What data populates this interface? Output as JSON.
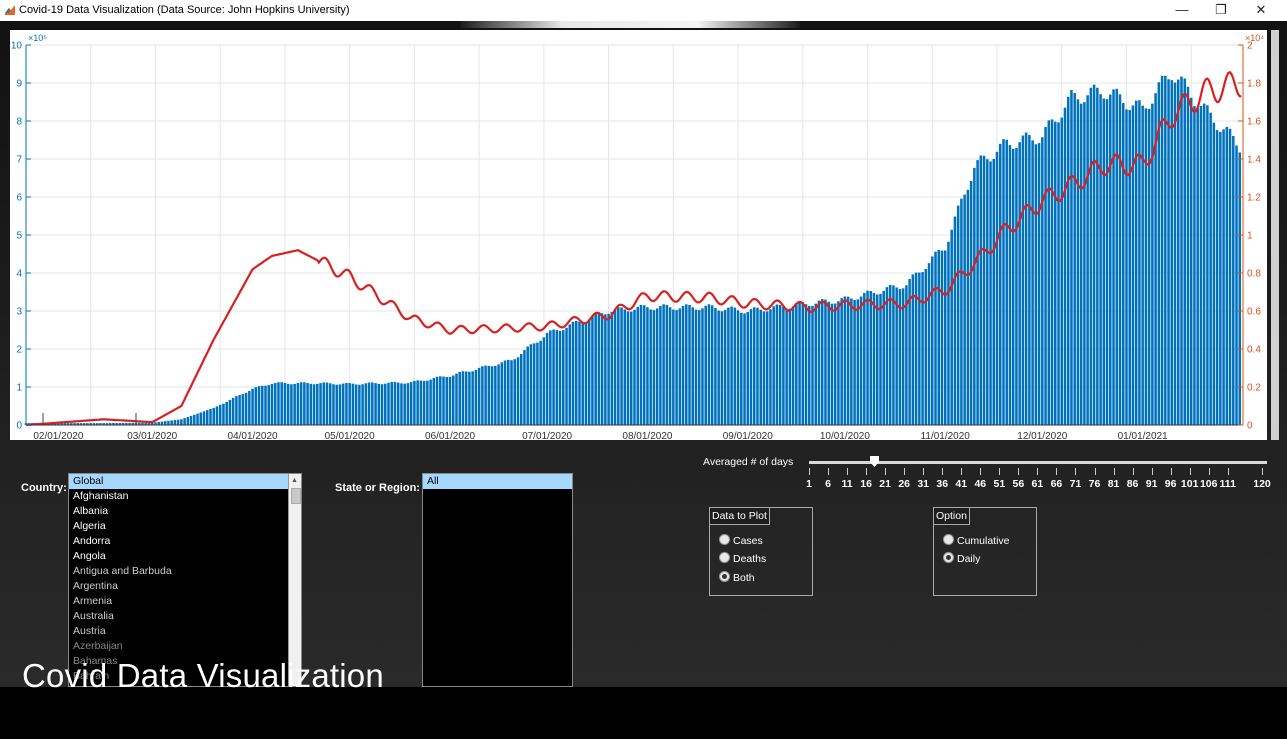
{
  "window": {
    "title": "Covid-19 Data Visualization (Data Source: John Hopkins University)",
    "min": "—",
    "max": "❐",
    "close": "✕"
  },
  "labels": {
    "country": "Country:",
    "state": "State or Region:",
    "averaged": "Averaged # of days"
  },
  "countries": [
    "Global",
    "Afghanistan",
    "Albania",
    "Algeria",
    "Andorra",
    "Angola",
    "Antigua and Barbuda",
    "Argentina",
    "Armenia",
    "Australia",
    "Austria",
    "Azerbaijan",
    "Bahamas",
    "Bahrain"
  ],
  "states": [
    "All"
  ],
  "slider": {
    "value": 19,
    "min": 1,
    "max": 120,
    "tick_labels": [
      "1",
      "6",
      "11",
      "16",
      "21",
      "26",
      "31",
      "36",
      "41",
      "46",
      "51",
      "56",
      "61",
      "66",
      "71",
      "76",
      "81",
      "86",
      "91",
      "96",
      "101",
      "106",
      "111",
      "120"
    ]
  },
  "data_to_plot": {
    "title": "Data to Plot",
    "options": [
      "Cases",
      "Deaths",
      "Both"
    ],
    "selected": 2
  },
  "option": {
    "title": "Option",
    "options": [
      "Cumulative",
      "Daily"
    ],
    "selected": 1
  },
  "caption": "Covid Data Visualization",
  "chart_data": {
    "type": "bar+line",
    "x_tick_labels": [
      "02/01/2020",
      "03/01/2020",
      "04/01/2020",
      "05/01/2020",
      "06/01/2020",
      "07/01/2020",
      "08/01/2020",
      "09/01/2020",
      "10/01/2020",
      "11/01/2020",
      "12/01/2020",
      "01/01/2021"
    ],
    "y_left": {
      "ticks": [
        "0",
        "1",
        "2",
        "3",
        "4",
        "5",
        "6",
        "7",
        "8",
        "9",
        "10"
      ],
      "exponent": "×10⁵",
      "color": "#0072bd",
      "ylim": [
        0,
        1000000
      ]
    },
    "y_right": {
      "ticks": [
        "0",
        "0.2",
        "0.4",
        "0.6",
        "0.8",
        "1",
        "1.2",
        "1.4",
        "1.6",
        "1.8",
        "2"
      ],
      "exponent": "×10⁴",
      "color": "#d95319",
      "ylim": [
        0,
        20000
      ]
    },
    "bar_series": {
      "name": "Cases",
      "color": "#0072bd",
      "knots_date": [
        "2020-01-22",
        "2020-02-15",
        "2020-03-01",
        "2020-03-10",
        "2020-03-20",
        "2020-04-01",
        "2020-04-07",
        "2020-04-20",
        "2020-05-01",
        "2020-05-20",
        "2020-06-01",
        "2020-06-20",
        "2020-07-01",
        "2020-07-20",
        "2020-08-01",
        "2020-08-20",
        "2020-09-01",
        "2020-09-20",
        "2020-10-01",
        "2020-10-20",
        "2020-11-01",
        "2020-11-10",
        "2020-11-20",
        "2020-12-01",
        "2020-12-10",
        "2020-12-20",
        "2021-01-01",
        "2021-01-10",
        "2021-01-20",
        "2021-01-31"
      ],
      "knots_value": [
        5000,
        5000,
        6000,
        15000,
        45000,
        95000,
        110000,
        110000,
        108000,
        112000,
        130000,
        170000,
        240000,
        300000,
        310000,
        310000,
        300000,
        320000,
        330000,
        370000,
        470000,
        680000,
        740000,
        760000,
        860000,
        880000,
        830000,
        930000,
        830000,
        735000
      ]
    },
    "line_series": {
      "name": "Deaths",
      "color": "#d92020",
      "knots_date": [
        "2020-01-22",
        "2020-02-15",
        "2020-03-01",
        "2020-03-10",
        "2020-03-20",
        "2020-04-01",
        "2020-04-07",
        "2020-04-15",
        "2020-05-01",
        "2020-05-20",
        "2020-06-01",
        "2020-06-20",
        "2020-07-01",
        "2020-07-20",
        "2020-08-01",
        "2020-08-20",
        "2020-09-01",
        "2020-09-20",
        "2020-10-01",
        "2020-10-20",
        "2020-11-01",
        "2020-11-10",
        "2020-11-20",
        "2020-12-01",
        "2020-12-10",
        "2020-12-20",
        "2021-01-01",
        "2021-01-10",
        "2021-01-20",
        "2021-01-31"
      ],
      "knots_value": [
        0,
        300,
        150,
        1000,
        4500,
        8200,
        8900,
        9200,
        7800,
        5600,
        5000,
        5100,
        5200,
        5800,
        6800,
        6700,
        6400,
        6200,
        6300,
        6400,
        7100,
        8500,
        10300,
        11800,
        12600,
        13700,
        13700,
        16300,
        17500,
        18000
      ]
    }
  }
}
